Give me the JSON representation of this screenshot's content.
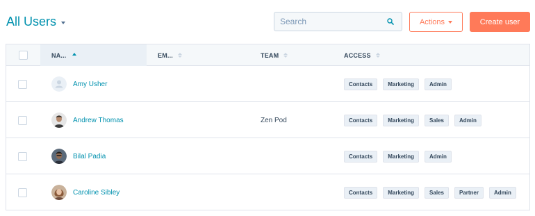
{
  "header": {
    "title": "All Users",
    "search_placeholder": "Search",
    "actions_label": "Actions",
    "create_label": "Create user"
  },
  "columns": [
    {
      "label": "NA...",
      "sort": "ascending"
    },
    {
      "label": "EM...",
      "sort": "none"
    },
    {
      "label": "TEAM",
      "sort": "none"
    },
    {
      "label": "ACCESS",
      "sort": "none"
    }
  ],
  "users": [
    {
      "name": "Amy Usher",
      "email": "",
      "team": "",
      "avatar": "default-avatar-icon",
      "access": [
        "Contacts",
        "Marketing",
        "Admin"
      ]
    },
    {
      "name": "Andrew Thomas",
      "email": "",
      "team": "Zen Pod",
      "avatar": "photo",
      "access": [
        "Contacts",
        "Marketing",
        "Sales",
        "Admin"
      ]
    },
    {
      "name": "Bilal Padia",
      "email": "",
      "team": "",
      "avatar": "photo",
      "access": [
        "Contacts",
        "Marketing",
        "Admin"
      ]
    },
    {
      "name": "Caroline Sibley",
      "email": "",
      "team": "",
      "avatar": "photo",
      "access": [
        "Contacts",
        "Marketing",
        "Sales",
        "Partner",
        "Admin"
      ]
    }
  ],
  "colors": {
    "accent": "#ff7a59",
    "link": "#0091ae",
    "text": "#33475b",
    "border": "#dfe3eb"
  }
}
